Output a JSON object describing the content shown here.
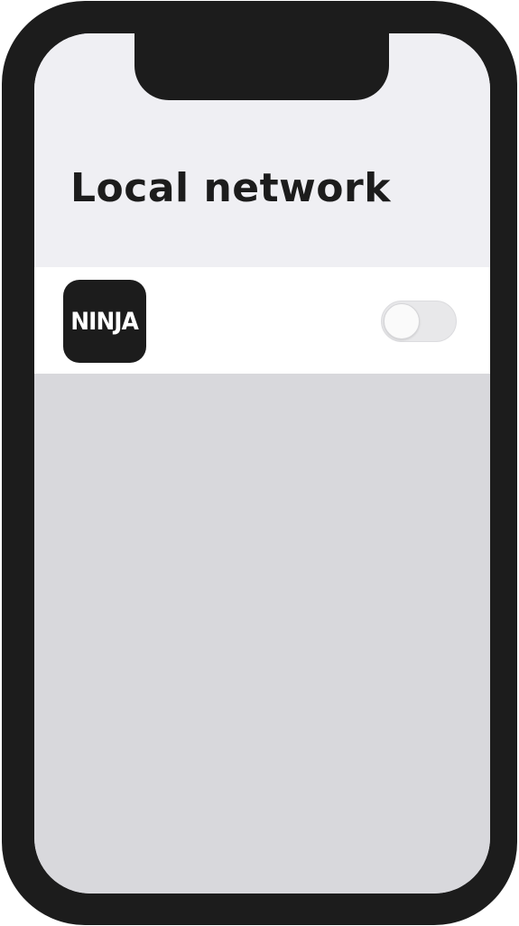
{
  "header": {
    "title": "Local network"
  },
  "app_row": {
    "app_icon_text": "NINJA",
    "toggle": {
      "state": "off"
    }
  },
  "colors": {
    "device_frame": "#1c1c1c",
    "header_background": "#efeff3",
    "row_background": "#ffffff",
    "empty_background": "#d8d8dc",
    "toggle_track": "#e8e8ea"
  }
}
